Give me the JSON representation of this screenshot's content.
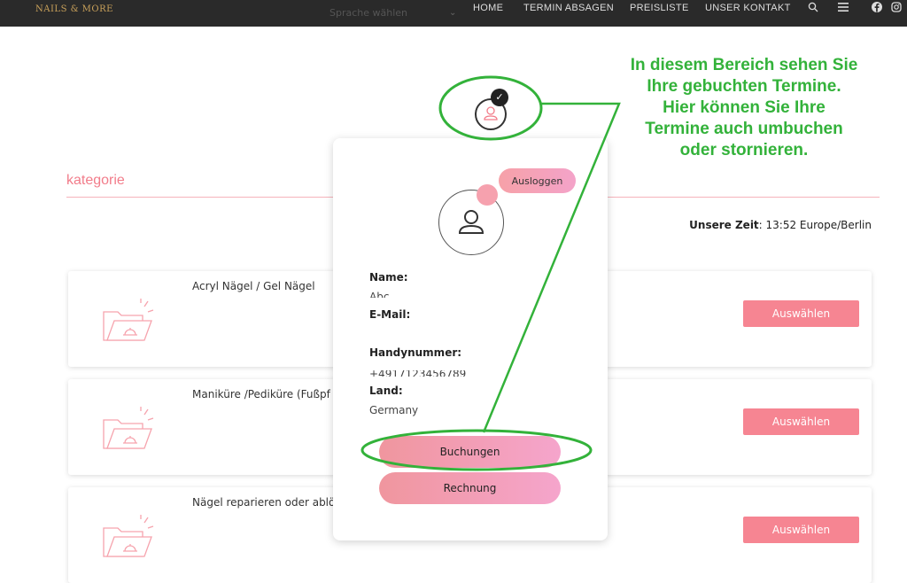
{
  "header": {
    "logo": "NAILS & MORE",
    "language": "Sprache wählen",
    "nav": [
      "HOME",
      "TERMIN ABSAGEN",
      "PREISLISTE",
      "UNSER KONTAKT"
    ]
  },
  "section": {
    "title": "kategorie",
    "time_label": "Unsere Zeit",
    "time_value": ": 13:52 Europe/Berlin"
  },
  "categories": [
    {
      "title": "Acryl Nägel / Gel Nägel",
      "button": "Auswählen"
    },
    {
      "title": "Maniküre /Pediküre (Fußpf",
      "button": "Auswählen"
    },
    {
      "title": "Nägel reparieren oder ablö",
      "button": "Auswählen"
    }
  ],
  "profile_panel": {
    "logout": "Ausloggen",
    "name_label": "Name:",
    "name_value": "Abc",
    "email_label": "E-Mail:",
    "email_value": "",
    "phone_label": "Handynummer:",
    "phone_value": "+4917123456789",
    "country_label": "Land:",
    "country_value": "Germany",
    "bookings_button": "Buchungen",
    "invoice_button": "Rechnung"
  },
  "annotation": {
    "lines": [
      "In diesem Bereich sehen Sie",
      "Ihre gebuchten Termine.",
      "Hier können Sie Ihre",
      "Termine auch umbuchen",
      "oder stornieren."
    ],
    "color": "#33b23a"
  },
  "colors": {
    "accent": "#f68592",
    "topbar": "#2a2a2a"
  },
  "icons": [
    "search-icon",
    "menu-icon",
    "facebook-icon",
    "instagram-icon",
    "user-icon",
    "check-icon",
    "folder-icon"
  ]
}
